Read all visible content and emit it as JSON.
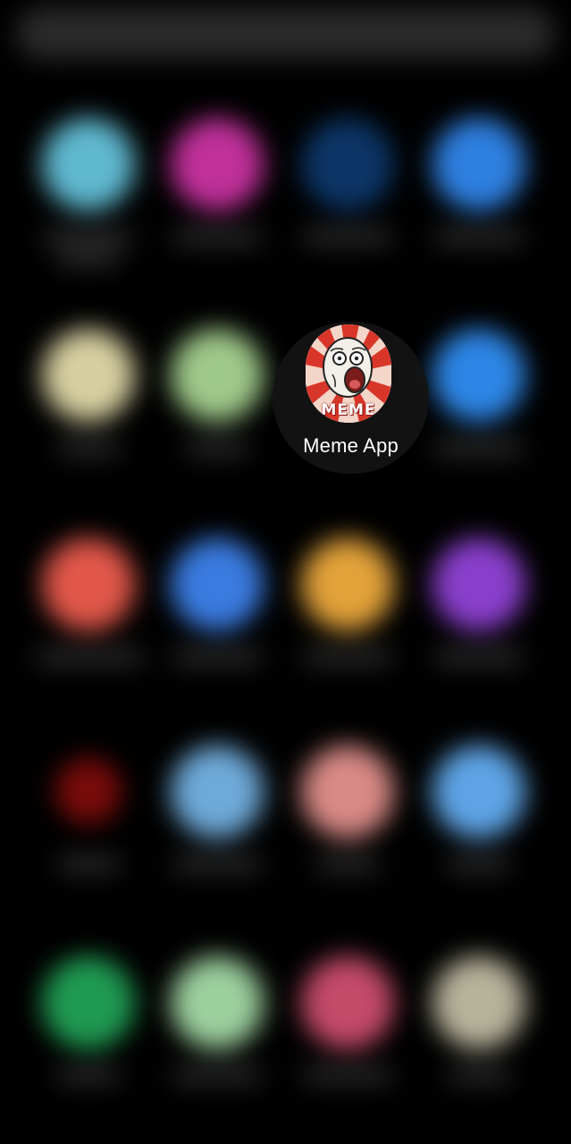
{
  "focused_app": {
    "label": "Meme App",
    "icon": "meme-face-icon",
    "icon_text": "MEME"
  },
  "background_apps": [
    {
      "color": "#5fb8d0",
      "icon": "blurred-app-icon"
    },
    {
      "color": "#c0309a",
      "icon": "blurred-app-icon"
    },
    {
      "color": "#0c3566",
      "icon": "blurred-app-icon"
    },
    {
      "color": "#2e7fe0",
      "icon": "blurred-app-icon"
    },
    {
      "color": "#d6cfa0",
      "icon": "blurred-app-icon"
    },
    {
      "color": "#9fc98a",
      "icon": "blurred-app-icon"
    },
    {
      "color": "#2d86e6",
      "icon": "blurred-app-icon"
    },
    {
      "color": "#e2574a",
      "icon": "blurred-app-icon"
    },
    {
      "color": "#3a7be0",
      "icon": "blurred-app-icon"
    },
    {
      "color": "#e3a23a",
      "icon": "blurred-app-icon"
    },
    {
      "color": "#8a3fcc",
      "icon": "blurred-app-icon"
    },
    {
      "color": "#7a0b0b",
      "icon": "blurred-app-icon"
    },
    {
      "color": "#6ea9d8",
      "icon": "blurred-app-icon"
    },
    {
      "color": "#d98a86",
      "icon": "blurred-app-icon"
    },
    {
      "color": "#5ea4e6",
      "icon": "blurred-app-icon"
    },
    {
      "color": "#1f9a52",
      "icon": "blurred-app-icon"
    },
    {
      "color": "#9ccf9e",
      "icon": "blurred-app-icon"
    },
    {
      "color": "#c44a6a",
      "icon": "blurred-app-icon"
    },
    {
      "color": "#b7b29a",
      "icon": "blurred-app-icon"
    }
  ]
}
